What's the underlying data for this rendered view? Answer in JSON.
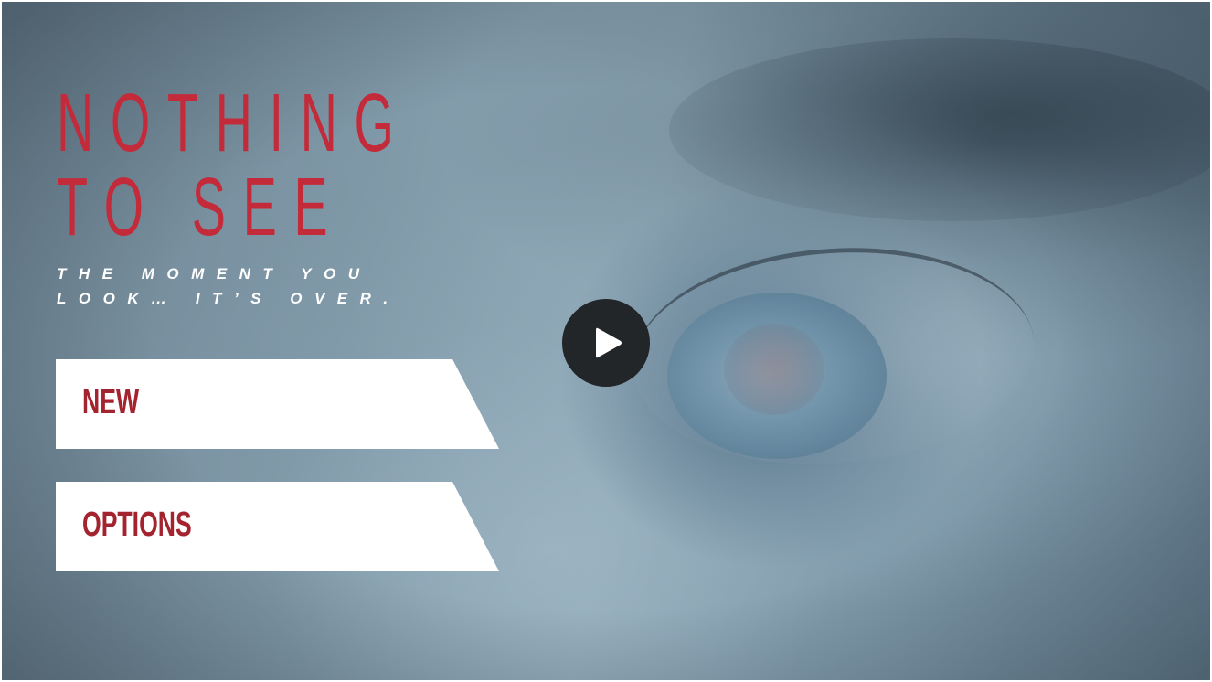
{
  "title": {
    "line1": "NOTHING",
    "line2": "TO SEE"
  },
  "tagline": {
    "line1": "THE MOMENT YOU",
    "line2": "LOOK… IT’S OVER."
  },
  "menu": {
    "new_label": "NEW",
    "options_label": "OPTIONS"
  },
  "play": {
    "icon": "play-icon"
  },
  "colors": {
    "title": "#c42b3a",
    "button_text": "#a3232f",
    "button_bg": "#ffffff",
    "play_bg": "#222629"
  }
}
